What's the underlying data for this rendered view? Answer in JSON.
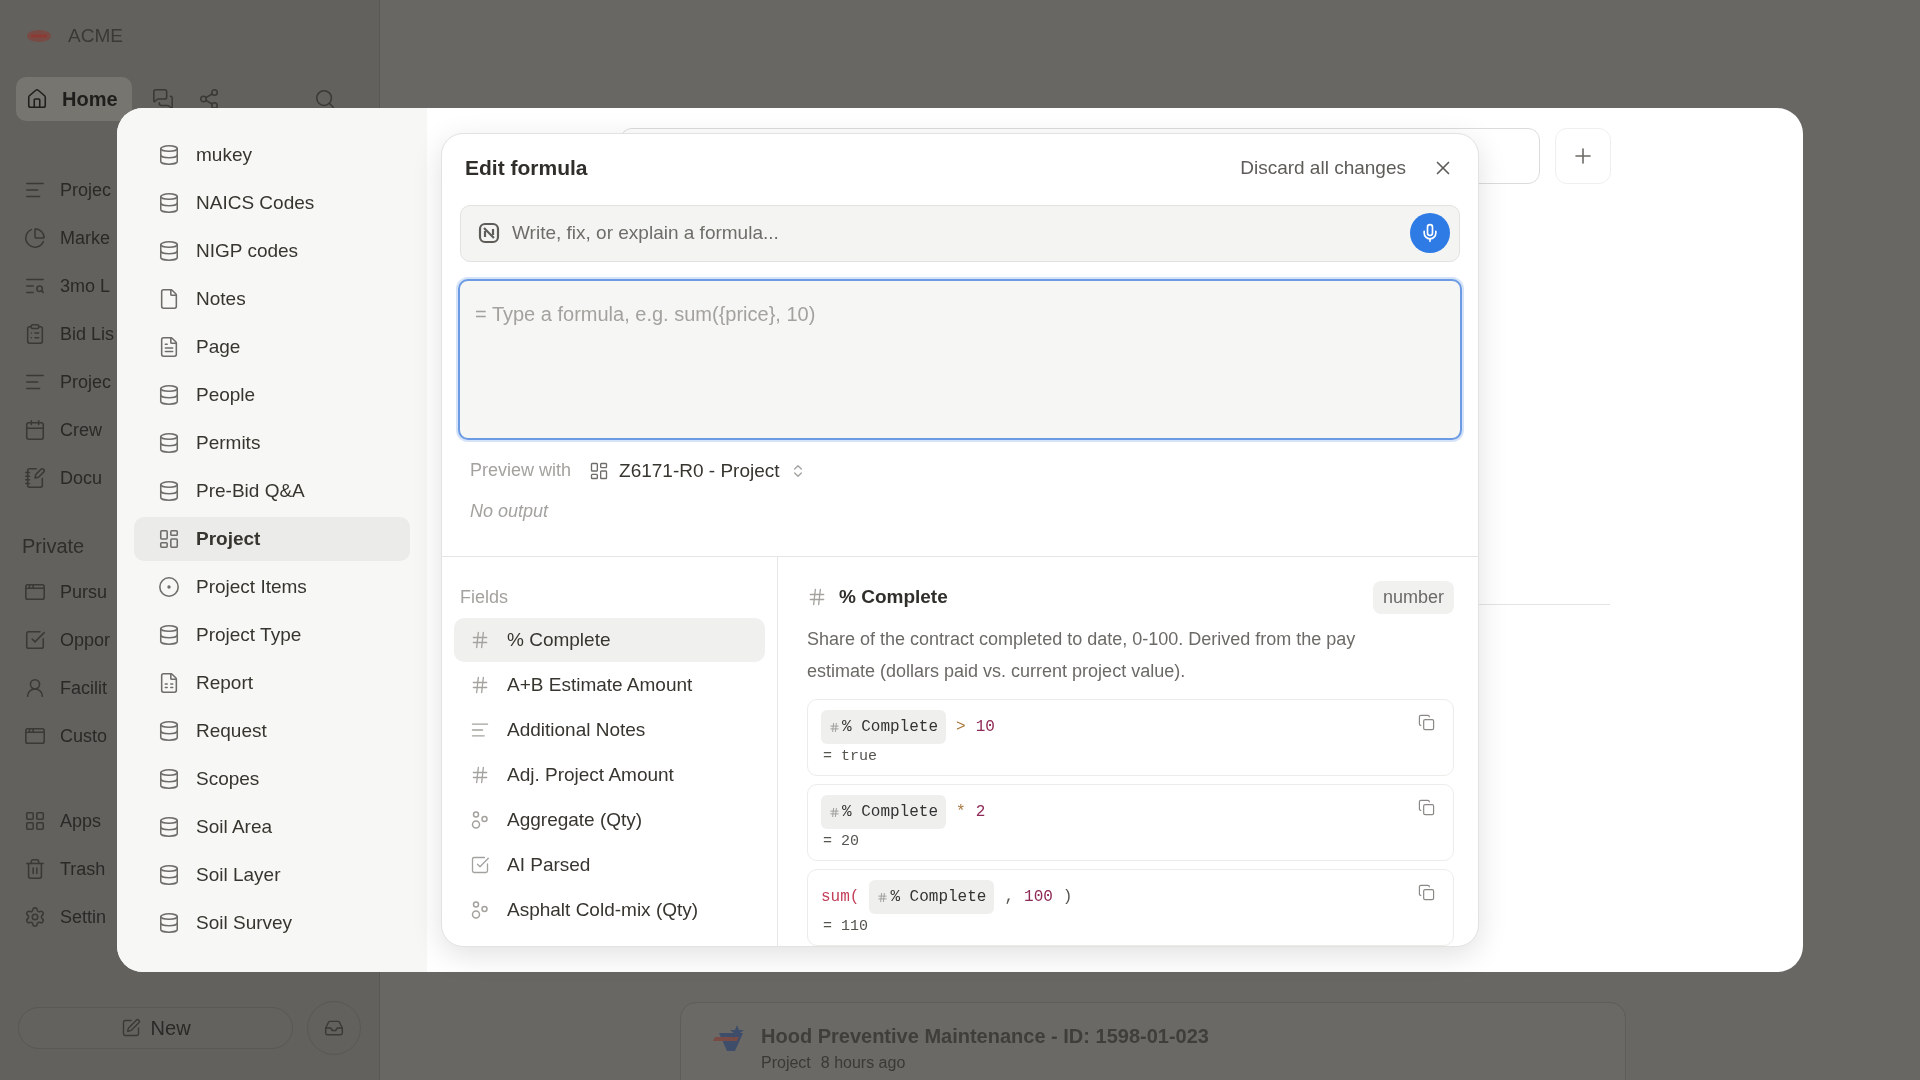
{
  "app": {
    "brand": "ACME",
    "home": {
      "label": "Home",
      "selected": true
    },
    "nav_items": [
      {
        "label": "Projec",
        "kind": "chart"
      },
      {
        "label": "Marke",
        "kind": "pie"
      },
      {
        "label": "3mo L",
        "kind": "search-list"
      },
      {
        "label": "Bid Lis",
        "kind": "clipboard"
      },
      {
        "label": "Projec",
        "kind": "chart"
      },
      {
        "label": "Crew",
        "kind": "calendar"
      },
      {
        "label": "Docu",
        "kind": "notebook"
      }
    ],
    "private_heading": "Private",
    "private_items": [
      {
        "label": "Pursu",
        "kind": "window"
      },
      {
        "label": "Oppor",
        "kind": "check"
      },
      {
        "label": "Facilit",
        "kind": "person"
      },
      {
        "label": "Custo",
        "kind": "window"
      }
    ],
    "footer_items": [
      {
        "label": "Apps",
        "kind": "apps"
      },
      {
        "label": "Trash",
        "kind": "trash"
      },
      {
        "label": "Settin",
        "kind": "settings"
      }
    ],
    "new_button": "New"
  },
  "recent": {
    "title": "Hood Preventive Maintenance - ID: 1598-01-023",
    "type": "Project",
    "time": "8 hours ago"
  },
  "picker": {
    "items": [
      {
        "label": "mukey",
        "kind": "database",
        "selected": false
      },
      {
        "label": "NAICS Codes",
        "kind": "database",
        "selected": false
      },
      {
        "label": "NIGP codes",
        "kind": "database",
        "selected": false
      },
      {
        "label": "Notes",
        "kind": "page",
        "selected": false
      },
      {
        "label": "Page",
        "kind": "doc",
        "selected": false
      },
      {
        "label": "People",
        "kind": "database",
        "selected": false
      },
      {
        "label": "Permits",
        "kind": "database",
        "selected": false
      },
      {
        "label": "Pre-Bid Q&A",
        "kind": "database",
        "selected": false
      },
      {
        "label": "Project",
        "kind": "view",
        "selected": true
      },
      {
        "label": "Project Items",
        "kind": "item",
        "selected": false
      },
      {
        "label": "Project Type",
        "kind": "database",
        "selected": false
      },
      {
        "label": "Report",
        "kind": "report",
        "selected": false
      },
      {
        "label": "Request",
        "kind": "database",
        "selected": false
      },
      {
        "label": "Scopes",
        "kind": "database",
        "selected": false
      },
      {
        "label": "Soil Area",
        "kind": "database",
        "selected": false
      },
      {
        "label": "Soil Layer",
        "kind": "database",
        "selected": false
      },
      {
        "label": "Soil Survey",
        "kind": "database",
        "selected": false
      }
    ]
  },
  "formula_editor": {
    "title": "Edit formula",
    "discard": "Discard all changes",
    "ai_placeholder": "Write, fix, or explain a formula...",
    "formula_placeholder": "= Type a formula, e.g. sum({price}, 10)",
    "preview_label": "Preview with",
    "preview_target": "Z6171-R0 - Project",
    "output": "No output",
    "fields": {
      "heading": "Fields",
      "items": [
        {
          "label": "% Complete",
          "kind": "number",
          "selected": true
        },
        {
          "label": "A+B Estimate Amount",
          "kind": "number",
          "selected": false
        },
        {
          "label": "Additional Notes",
          "kind": "text",
          "selected": false
        },
        {
          "label": "Adj. Project Amount",
          "kind": "number",
          "selected": false
        },
        {
          "label": "Aggregate (Qty)",
          "kind": "rollup",
          "selected": false
        },
        {
          "label": "AI Parsed",
          "kind": "checkbox",
          "selected": false
        },
        {
          "label": "Asphalt Cold-mix (Qty)",
          "kind": "rollup",
          "selected": false
        }
      ]
    },
    "detail": {
      "name": "% Complete",
      "type": "number",
      "description": "Share of the contract completed to date, 0-100. Derived from the pay estimate (dollars paid vs. current project value).",
      "examples": [
        {
          "tokens": [
            {
              "kind": "field",
              "text": "% Complete"
            },
            {
              "kind": "operator",
              "text": ">"
            },
            {
              "kind": "number",
              "text": "10"
            }
          ],
          "result": "= true"
        },
        {
          "tokens": [
            {
              "kind": "field",
              "text": "% Complete"
            },
            {
              "kind": "operator",
              "text": "*"
            },
            {
              "kind": "number",
              "text": "2"
            }
          ],
          "result": "= 20"
        },
        {
          "tokens": [
            {
              "kind": "function",
              "text": "sum("
            },
            {
              "kind": "field",
              "text": "% Complete"
            },
            {
              "kind": "punct",
              "text": ","
            },
            {
              "kind": "number",
              "text": "100"
            },
            {
              "kind": "punct",
              "text": ")"
            }
          ],
          "result": "= 110"
        }
      ]
    }
  }
}
